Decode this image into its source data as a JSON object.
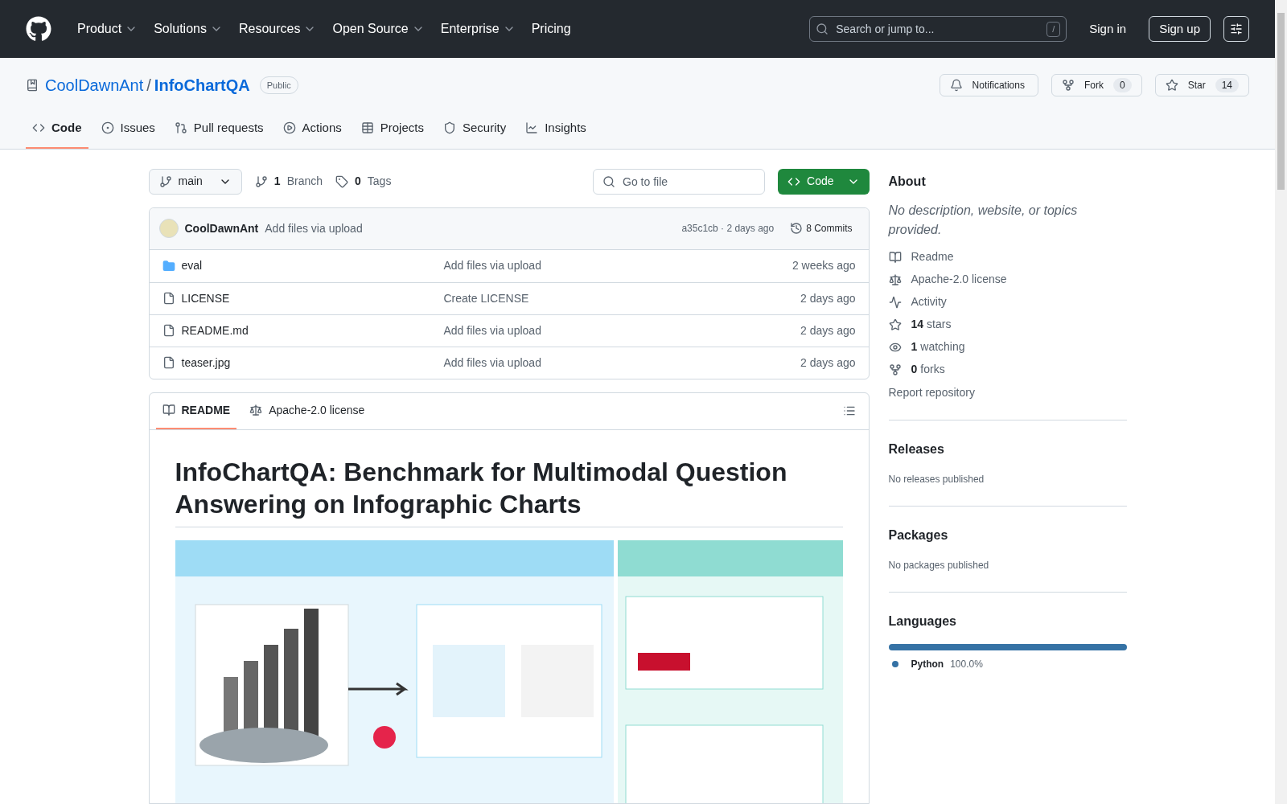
{
  "header": {
    "nav": [
      {
        "label": "Product",
        "has_menu": true
      },
      {
        "label": "Solutions",
        "has_menu": true
      },
      {
        "label": "Resources",
        "has_menu": true
      },
      {
        "label": "Open Source",
        "has_menu": true
      },
      {
        "label": "Enterprise",
        "has_menu": true
      },
      {
        "label": "Pricing",
        "has_menu": false
      }
    ],
    "search": {
      "placeholder": "Search or jump to...",
      "shortcut": "/"
    },
    "sign_in": "Sign in",
    "sign_up": "Sign up"
  },
  "repo": {
    "owner": "CoolDawnAnt",
    "separator": "/",
    "name": "InfoChartQA",
    "visibility": "Public",
    "actions": [
      {
        "label": "Notifications"
      },
      {
        "label": "Fork",
        "count": "0"
      },
      {
        "label": "Star",
        "count": "14"
      }
    ],
    "tabs": [
      {
        "label": "Code",
        "selected": true
      },
      {
        "label": "Issues",
        "selected": false
      },
      {
        "label": "Pull requests",
        "selected": false
      },
      {
        "label": "Actions",
        "selected": false
      },
      {
        "label": "Projects",
        "selected": false
      },
      {
        "label": "Security",
        "selected": false
      },
      {
        "label": "Insights",
        "selected": false
      }
    ]
  },
  "toolbar": {
    "branch": "main",
    "branches_count": "1",
    "branches_label": "Branch",
    "tags_count": "0",
    "tags_label": "Tags",
    "go_to_file": {
      "placeholder": "Go to file"
    },
    "code_button": "Code"
  },
  "latest_commit": {
    "author": "CoolDawnAnt",
    "message": "Add files via upload",
    "info": "a35c1cb · 2 days ago",
    "commits": "8 Commits"
  },
  "files": [
    {
      "kind": "folder",
      "name": "eval",
      "message": "Add files via upload",
      "time": "2 weeks ago"
    },
    {
      "kind": "file",
      "name": "LICENSE",
      "message": "Create LICENSE",
      "time": "2 days ago"
    },
    {
      "kind": "file",
      "name": "README.md",
      "message": "Add files via upload",
      "time": "2 days ago"
    },
    {
      "kind": "file",
      "name": "teaser.jpg",
      "message": "Add files via upload",
      "time": "2 days ago"
    }
  ],
  "readme": {
    "tabs": [
      {
        "label": "README",
        "selected": true
      },
      {
        "label": "Apache-2.0 license",
        "selected": false
      }
    ],
    "title": "InfoChartQA: Benchmark for Multimodal Question Answering on Infographic Charts"
  },
  "about": {
    "title": "About",
    "description": "No description, website, or topics provided.",
    "links": [
      {
        "label": "Readme"
      },
      {
        "label": "Apache-2.0 license"
      },
      {
        "label": "Activity"
      },
      {
        "count": "14",
        "label": "stars"
      },
      {
        "count": "1",
        "label": "watching"
      },
      {
        "count": "0",
        "label": "forks"
      }
    ],
    "report": "Report repository"
  },
  "releases": {
    "title": "Releases",
    "note": "No releases published"
  },
  "packages": {
    "title": "Packages",
    "note": "No packages published"
  },
  "languages": {
    "title": "Languages",
    "items": [
      {
        "name": "Python",
        "share": "100.0%",
        "level": 1,
        "color": "#3572a5"
      }
    ]
  }
}
